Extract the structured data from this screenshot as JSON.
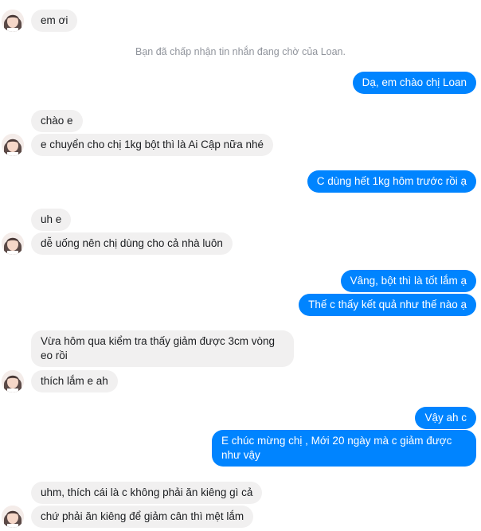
{
  "system_notice": "Bạn đã chấp nhận tin nhắn đang chờ của Loan.",
  "contact": {
    "avatar_icon": "profile-photo-icon"
  },
  "messages": [
    {
      "side": "in",
      "text": "em ơi"
    },
    {
      "side": "out",
      "text": "Dạ, em chào chị Loan"
    },
    {
      "side": "in",
      "text": "chào e"
    },
    {
      "side": "in",
      "text": "e chuyển cho chị 1kg bột thì là Ai Cập nữa nhé"
    },
    {
      "side": "out",
      "text": "C dùng hết 1kg hôm trước rồi ạ"
    },
    {
      "side": "in",
      "text": "uh e"
    },
    {
      "side": "in",
      "text": "dễ uống nên chị dùng cho cả nhà luôn"
    },
    {
      "side": "out",
      "text": "Vâng, bột thì là tốt lắm ạ"
    },
    {
      "side": "out",
      "text": "Thế c thấy kết quả như thế nào ạ"
    },
    {
      "side": "in",
      "text": "Vừa hôm qua kiểm tra thấy giảm được 3cm vòng eo rồi"
    },
    {
      "side": "in",
      "text": "thích lắm e ah"
    },
    {
      "side": "out",
      "text": "Vậy ah c"
    },
    {
      "side": "out",
      "text": "E chúc mừng chị , Mới 20 ngày mà c giảm được như vậy"
    },
    {
      "side": "in",
      "text": "uhm, thích cái là c không phải ăn kiêng gì cả"
    },
    {
      "side": "in",
      "text": "chứ phải ăn kiêng để giảm cân thì mệt lắm"
    }
  ],
  "colors": {
    "outgoing": "#0084ff",
    "incoming": "#f1f0f0",
    "notice": "#90949c"
  }
}
